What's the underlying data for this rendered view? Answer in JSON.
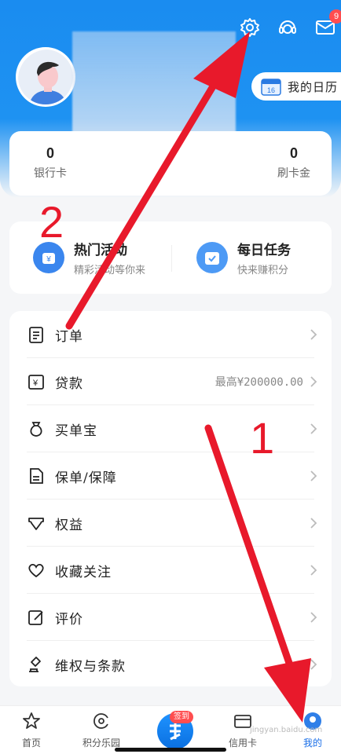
{
  "header": {
    "mail_badge": "9",
    "calendar_label": "我的日历",
    "calendar_day": "16"
  },
  "stats": [
    {
      "value": "0",
      "label": "银行卡"
    },
    {
      "value": "0",
      "label": "刷卡金"
    }
  ],
  "activities": [
    {
      "title": "热门活动",
      "subtitle": "精彩活动等你来"
    },
    {
      "title": "每日任务",
      "subtitle": "快来赚积分"
    }
  ],
  "menu": [
    {
      "label": "订单",
      "icon": "clipboard-icon"
    },
    {
      "label": "贷款",
      "icon": "yen-card-icon",
      "value": "最高¥200000.00"
    },
    {
      "label": "买单宝",
      "icon": "money-bag-icon"
    },
    {
      "label": "保单/保障",
      "icon": "document-icon"
    },
    {
      "label": "权益",
      "icon": "ticket-icon"
    },
    {
      "label": "收藏关注",
      "icon": "heart-icon"
    },
    {
      "label": "评价",
      "icon": "edit-icon"
    },
    {
      "label": "维权与条款",
      "icon": "gavel-icon"
    }
  ],
  "tabs": [
    {
      "label": "首页",
      "icon": "star-icon"
    },
    {
      "label": "积分乐园",
      "icon": "points-icon"
    },
    {
      "label": "签到",
      "icon": "checkin-icon"
    },
    {
      "label": "信用卡",
      "icon": "card-icon"
    },
    {
      "label": "我的",
      "icon": "profile-icon",
      "active": true
    }
  ],
  "annotations": {
    "one": "1",
    "two": "2"
  },
  "watermark": "jingyan.baidu.com",
  "colors": {
    "brand_blue": "#1a8cf0",
    "arrow_red": "#e8192b",
    "badge_red": "#ff4d4f"
  }
}
